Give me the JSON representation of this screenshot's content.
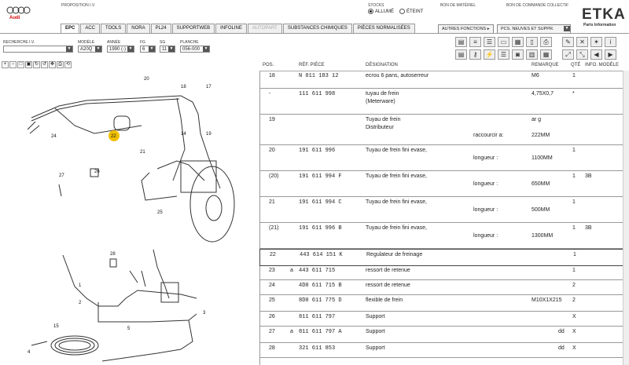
{
  "header": {
    "proposition": "PROPOSITION I.V.",
    "brand": "Audi",
    "stock_label": "STOCKS",
    "stock_on": "ALLUMÉ",
    "stock_off": "ÉTEINT",
    "bon_materiel": "BON DE MATÉRIEL",
    "bon_commande": "BON DE COMMANDE COLLECTIF",
    "etka": "ETKA",
    "etka_sub": "Parts Information",
    "autres_fonctions": "AUTRES FONCTIONS ▸",
    "pcs": "PCS. NEUVES ET SUPPR.",
    "tabs": [
      "EPC",
      "ACC",
      "TOOLS",
      "NORA",
      "PL24",
      "SUPPORTWEB",
      "INFOLINE",
      "AUTOPART",
      "SUBSTANCES CHIMIQUES",
      "PIÈCES NORMALISÉES"
    ]
  },
  "selection": {
    "recherche_label": "RECHERCHE I.V.",
    "modele_label": "MODÈLE",
    "modele": "A20Q",
    "annee_label": "ANNÉE",
    "annee": "1990 (-)",
    "fg_label": "FG",
    "fg": "6",
    "sg_label": "SG",
    "sg": "11",
    "planche_label": "PLANCHE",
    "planche": "056-000"
  },
  "columns": [
    "POS.",
    "RÉF. PIÈCE",
    "DÉSIGNATION",
    "REMARQUE",
    "QTÉ",
    "INFO. MODÈLE"
  ],
  "rows": [
    {
      "pos": "18",
      "pre": "",
      "ref": "N   011 183 12",
      "des": "ecrou 6 pans, autoserreur",
      "sub": "",
      "rem": "M6",
      "qty": "1",
      "info": ""
    },
    {
      "pos": "-",
      "pre": "",
      "ref": "111 611 998",
      "des": "tuyau de frein",
      "des2": "(Meterware)",
      "sub": "",
      "rem": "4,75X0,7",
      "qty": "*",
      "info": ""
    },
    {
      "pos": "19",
      "pre": "",
      "ref": "",
      "des": "Tuyau de frein",
      "des2": "Distributeur",
      "sub": "raccourcir a:",
      "rem": "ar g",
      "rem2": "222MM",
      "qty": "",
      "info": ""
    },
    {
      "pos": "20",
      "pre": "",
      "ref": "191 611 996",
      "des": "Tuyau de frein fini evase,",
      "sub": "longueur :",
      "rem": "",
      "rem2": "1100MM",
      "qty": "1",
      "info": ""
    },
    {
      "pos": "(20)",
      "pre": "",
      "ref": "191 611 994 F",
      "des": "Tuyau de frein fini evase,",
      "sub": "longueur :",
      "rem": "",
      "rem2": "650MM",
      "qty": "1",
      "info": "3B"
    },
    {
      "pos": "21",
      "pre": "",
      "ref": "191 611 994 C",
      "des": "Tuyau de frein fini evase,",
      "sub": "longueur :",
      "rem": "",
      "rem2": "500MM",
      "qty": "1",
      "info": ""
    },
    {
      "pos": "(21)",
      "pre": "",
      "ref": "191 611 996 B",
      "des": "Tuyau de frein fini evase,",
      "sub": "longueur :",
      "rem": "",
      "rem2": "1300MM",
      "qty": "1",
      "info": "3B"
    },
    {
      "pos": "22",
      "pre": "",
      "ref": "443 614 151 K",
      "des": "Regulateur de freinage",
      "sub": "",
      "rem": "",
      "qty": "1",
      "info": ""
    },
    {
      "pos": "23",
      "pre": "a",
      "ref": "443 611 715",
      "des": "ressort de retenue",
      "sub": "",
      "rem": "",
      "qty": "1",
      "info": ""
    },
    {
      "pos": "24",
      "pre": "",
      "ref": "4D0 611 715 B",
      "des": "ressort de retenue",
      "sub": "",
      "rem": "",
      "qty": "2",
      "info": ""
    },
    {
      "pos": "25",
      "pre": "",
      "ref": "8D0 611 775 D",
      "des": "flexible de frein",
      "sub": "",
      "rem": "M10X1X215",
      "qty": "2",
      "info": ""
    },
    {
      "pos": "26",
      "pre": "",
      "ref": "811 611 797",
      "des": "Support",
      "sub": "",
      "rem": "",
      "qty": "X",
      "info": ""
    },
    {
      "pos": "27",
      "pre": "a",
      "ref": "811 611 797 A",
      "des": "Support",
      "sub": "",
      "rem": "dd",
      "qty": "X",
      "info": ""
    },
    {
      "pos": "28",
      "pre": "",
      "ref": "321 611 853",
      "des": "Support",
      "sub": "",
      "rem": "dd",
      "qty": "X",
      "info": ""
    }
  ],
  "diagram": {
    "labels": [
      "20",
      "18",
      "17",
      "22",
      "24",
      "21",
      "19",
      "14",
      "27",
      "26",
      "25",
      "28",
      "2",
      "1",
      "5",
      "3",
      "15",
      "4"
    ],
    "highlight": "22",
    "highlight_color": "#f0c000"
  }
}
